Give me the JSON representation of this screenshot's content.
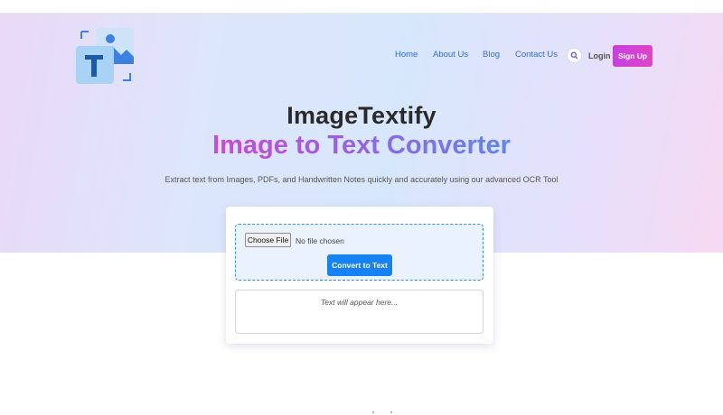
{
  "header": {
    "logo_icon": "text-image-logo-icon",
    "nav": {
      "items": [
        {
          "label": "Home"
        },
        {
          "label": "About Us"
        },
        {
          "label": "Blog"
        },
        {
          "label": "Contact Us"
        }
      ],
      "search_icon": "search-icon",
      "login_label": "Login",
      "signup_label": "Sign Up"
    }
  },
  "hero": {
    "site_name": "ImageTextify",
    "headline": "Image to Text Converter",
    "subtitle": "Extract text from Images, PDFs, and Handwritten Notes quickly and accurately using our advanced OCR Tool"
  },
  "converter": {
    "choose_file_label": "Choose File",
    "no_file_text": "No file chosen",
    "convert_label": "Convert to Text",
    "output_placeholder": "Text will appear here..."
  },
  "colors": {
    "nav_link": "#2f6fd0",
    "signup_gradient_start": "#c63fe0",
    "signup_gradient_end": "#e045c4",
    "convert_button": "#1583f5",
    "dropzone_border": "#3f8ee0",
    "headline_gradient_start": "#c94ad6",
    "headline_gradient_end": "#5c86f0"
  }
}
